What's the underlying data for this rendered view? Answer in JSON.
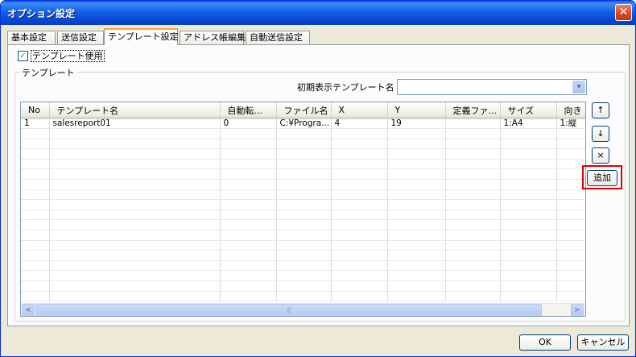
{
  "window": {
    "title": "オプション設定",
    "close_label": "✕"
  },
  "tabs": [
    {
      "label": "基本設定"
    },
    {
      "label": "送信設定"
    },
    {
      "label": "テンプレート設定"
    },
    {
      "label": "アドレス帳編集"
    },
    {
      "label": "自動送信設定"
    }
  ],
  "use_template": {
    "label": "テンプレート使用",
    "checked": true,
    "check_mark": "✓"
  },
  "template_group": {
    "legend": "テンプレート",
    "default_label": "初期表示テンプレート名",
    "default_value": "",
    "combo_arrow": "▾"
  },
  "table": {
    "headers": [
      "No",
      "テンプレート名",
      "自動転...",
      "ファイル名",
      "X",
      "Y",
      "定義ファ...",
      "サイズ",
      "向き"
    ],
    "rows": [
      [
        "1",
        "salesreport01",
        "0",
        "C:¥Progra...",
        "4",
        "19",
        "",
        "1:A4",
        "1:縦"
      ]
    ],
    "scroll_left": "<",
    "scroll_right": ">",
    "thumb_grip": "|||"
  },
  "side_buttons": {
    "up": "↑",
    "down": "↓",
    "delete": "×",
    "add": "追加"
  },
  "footer": {
    "ok": "OK",
    "cancel": "キャンセル"
  }
}
